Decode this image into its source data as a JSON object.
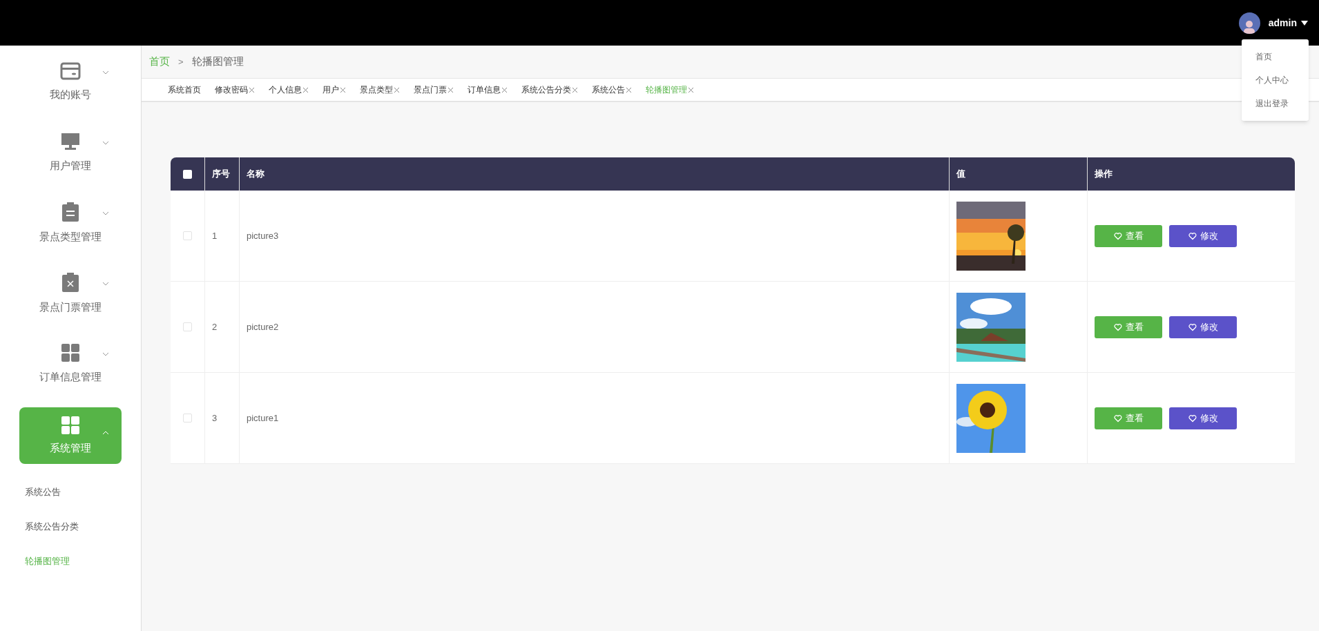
{
  "header": {
    "user": "admin",
    "menu": [
      {
        "label": "首页"
      },
      {
        "label": "个人中心"
      },
      {
        "label": "退出登录"
      }
    ]
  },
  "sidebar": {
    "items": [
      {
        "label": "我的账号",
        "expanded": false,
        "selected": false
      },
      {
        "label": "用户管理",
        "expanded": false,
        "selected": false
      },
      {
        "label": "景点类型管理",
        "expanded": false,
        "selected": false
      },
      {
        "label": "景点门票管理",
        "expanded": false,
        "selected": false
      },
      {
        "label": "订单信息管理",
        "expanded": false,
        "selected": false
      },
      {
        "label": "系统管理",
        "expanded": true,
        "selected": true,
        "children": [
          {
            "label": "系统公告",
            "selected": false
          },
          {
            "label": "系统公告分类",
            "selected": false
          },
          {
            "label": "轮播图管理",
            "selected": true
          }
        ]
      }
    ]
  },
  "breadcrumb": {
    "home": "首页",
    "separator": ">",
    "current": "轮播图管理"
  },
  "tabs": [
    {
      "label": "系统首页",
      "selected": false,
      "closable": false
    },
    {
      "label": "修改密码",
      "selected": false,
      "closable": true
    },
    {
      "label": "个人信息",
      "selected": false,
      "closable": true
    },
    {
      "label": "用户",
      "selected": false,
      "closable": true
    },
    {
      "label": "景点类型",
      "selected": false,
      "closable": true
    },
    {
      "label": "景点门票",
      "selected": false,
      "closable": true
    },
    {
      "label": "订单信息",
      "selected": false,
      "closable": true
    },
    {
      "label": "系统公告分类",
      "selected": false,
      "closable": true
    },
    {
      "label": "系统公告",
      "selected": false,
      "closable": true
    },
    {
      "label": "轮播图管理",
      "selected": true,
      "closable": true
    }
  ],
  "table": {
    "select_all_checked": false,
    "columns": [
      "序号",
      "名称",
      "值",
      "操作"
    ],
    "rows": [
      {
        "checked": false,
        "index": "1",
        "name": "picture3",
        "value": {
          "kind": "picture"
        },
        "actions": [
          "查看",
          "修改"
        ]
      },
      {
        "checked": false,
        "index": "2",
        "name": "picture2",
        "value": {
          "kind": "picture"
        },
        "actions": [
          "查看",
          "修改"
        ]
      },
      {
        "checked": false,
        "index": "3",
        "name": "picture1",
        "value": {
          "kind": "picture"
        },
        "actions": [
          "查看",
          "修改"
        ]
      }
    ]
  }
}
